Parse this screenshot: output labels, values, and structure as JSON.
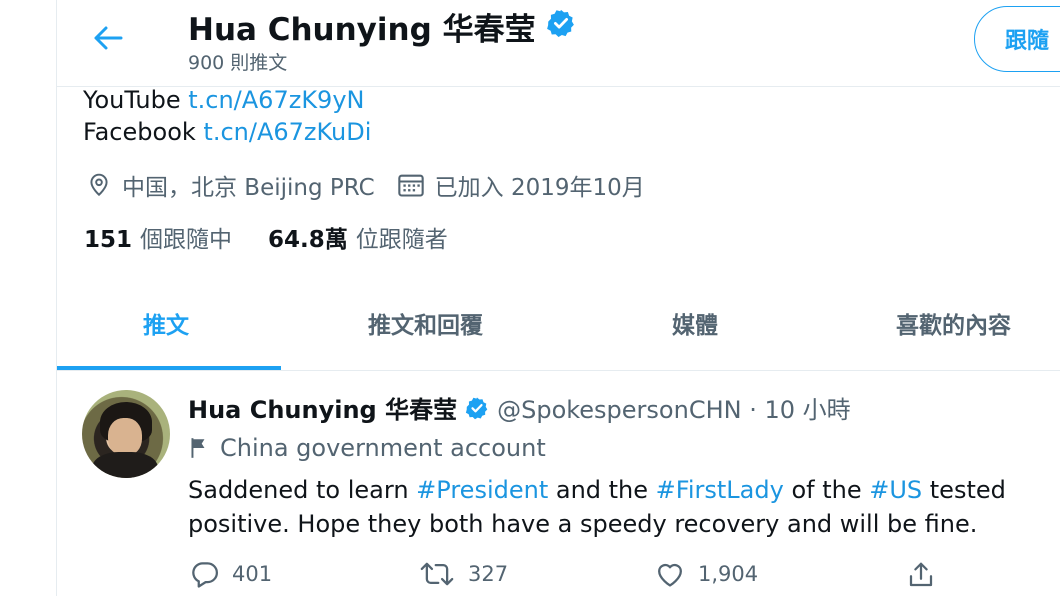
{
  "header": {
    "name": "Hua Chunying 华春莹",
    "tweet_count": "900 則推文",
    "follow_label": "跟隨"
  },
  "bio": {
    "youtube_label": "YouTube",
    "youtube_link": "t.cn/A67zK9yN",
    "facebook_label": "Facebook",
    "facebook_link": "t.cn/A67zKuDi"
  },
  "meta": {
    "location": "中国，北京 Beijing PRC",
    "joined": "已加入 2019年10月"
  },
  "stats": {
    "following_count": "151",
    "following_label": "個跟隨中",
    "followers_count": "64.8萬",
    "followers_label": "位跟隨者"
  },
  "tabs": [
    {
      "label": "推文",
      "active": true
    },
    {
      "label": "推文和回覆",
      "active": false
    },
    {
      "label": "媒體",
      "active": false
    },
    {
      "label": "喜歡的內容",
      "active": false
    }
  ],
  "tweet": {
    "author_name": "Hua Chunying 华春莹",
    "handle_time": "@SpokespersonCHN · 10 小時",
    "account_label": "China government account",
    "text_parts": {
      "p1": "Saddened to learn ",
      "tag1": "#President",
      "p2": " and the ",
      "tag2": "#FirstLady",
      "p3": " of the ",
      "tag3": "#US",
      "p4": " tested positive. Hope they both have a speedy recovery and will be fine."
    },
    "replies": "401",
    "retweets": "327",
    "likes": "1,904"
  },
  "icons": {
    "back": "arrow-left-icon",
    "verified": "verified-badge-icon",
    "location": "location-pin-icon",
    "calendar": "calendar-icon",
    "flag": "flag-icon",
    "reply": "reply-icon",
    "retweet": "retweet-icon",
    "like": "heart-icon",
    "share": "share-icon"
  },
  "colors": {
    "accent": "#1da1f2",
    "link": "#1b95e0",
    "secondary_text": "#536471",
    "divider": "#e6ecf0"
  }
}
